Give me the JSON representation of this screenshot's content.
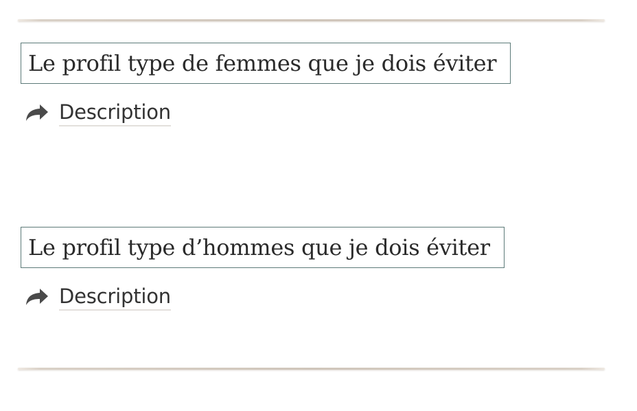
{
  "sections": [
    {
      "title": "Le profil type de femmes que je dois éviter",
      "link_label": "Description",
      "link_icon": "share-arrow-icon"
    },
    {
      "title": "Le profil type d’hommes que je dois éviter",
      "link_label": "Description",
      "link_icon": "share-arrow-icon"
    }
  ],
  "colors": {
    "title_border": "#5c7a78",
    "text": "#333333",
    "icon": "#4a4a4a",
    "rule": "#cfc5ba"
  }
}
